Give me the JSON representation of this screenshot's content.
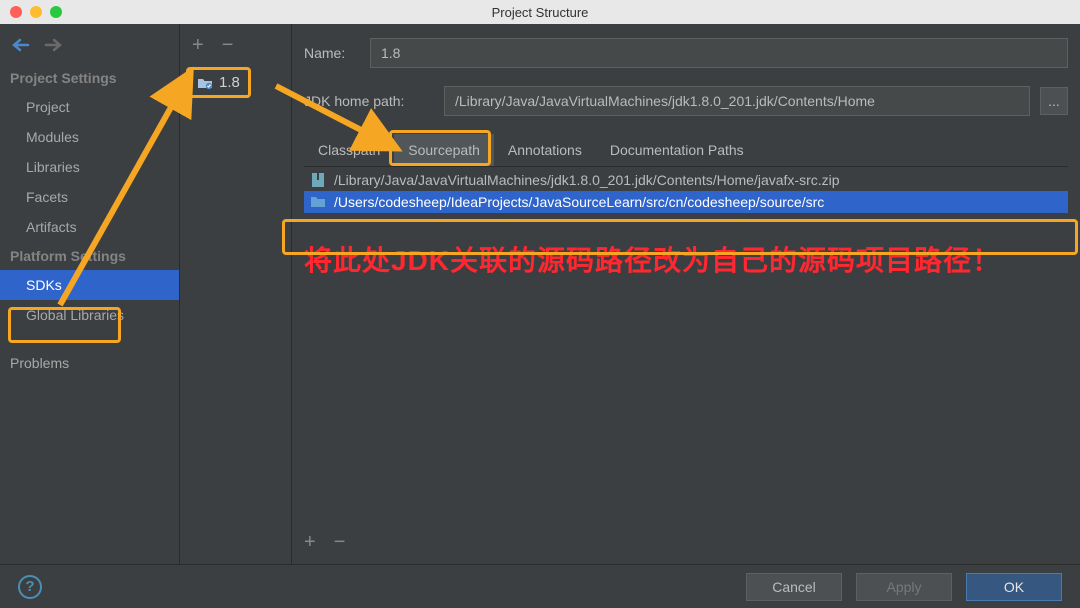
{
  "window": {
    "title": "Project Structure"
  },
  "sidebar": {
    "sections": [
      {
        "header": "Project Settings",
        "items": [
          "Project",
          "Modules",
          "Libraries",
          "Facets",
          "Artifacts"
        ]
      },
      {
        "header": "Platform Settings",
        "items": [
          "SDKs",
          "Global Libraries"
        ]
      }
    ],
    "extra": [
      "Problems"
    ],
    "selected": "SDKs"
  },
  "sdkList": {
    "items": [
      "1.8"
    ],
    "selected": "1.8"
  },
  "form": {
    "nameLabel": "Name:",
    "nameValue": "1.8",
    "jdkHomeLabel": "JDK home path:",
    "jdkHomeValue": "/Library/Java/JavaVirtualMachines/jdk1.8.0_201.jdk/Contents/Home",
    "browseLabel": "..."
  },
  "tabs": {
    "items": [
      "Classpath",
      "Sourcepath",
      "Annotations",
      "Documentation Paths"
    ],
    "active": "Sourcepath"
  },
  "sources": {
    "rows": [
      "/Library/Java/JavaVirtualMachines/jdk1.8.0_201.jdk/Contents/Home/javafx-src.zip",
      "/Users/codesheep/IdeaProjects/JavaSourceLearn/src/cn/codesheep/source/src"
    ],
    "selectedIndex": 1
  },
  "annotation": "将此处JDK关联的源码路径改为自己的源码项目路径！",
  "buttons": {
    "help": "?",
    "cancel": "Cancel",
    "apply": "Apply",
    "ok": "OK"
  }
}
